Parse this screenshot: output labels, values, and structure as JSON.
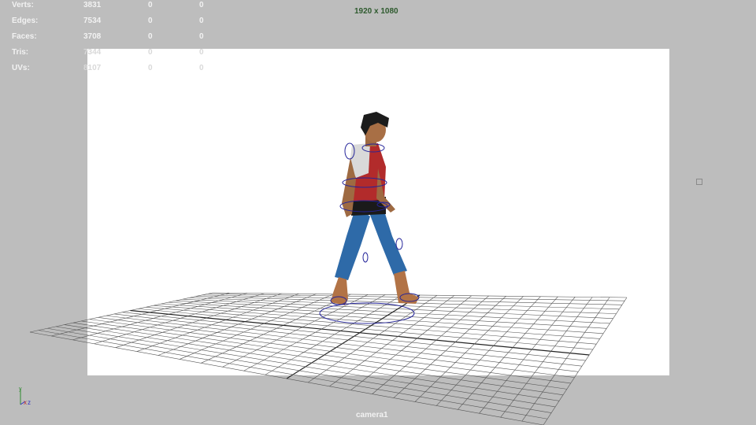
{
  "hud": {
    "rows": [
      {
        "label": "Verts:",
        "v1": "3831",
        "v2": "0",
        "v3": "0"
      },
      {
        "label": "Edges:",
        "v1": "7534",
        "v2": "0",
        "v3": "0"
      },
      {
        "label": "Faces:",
        "v1": "3708",
        "v2": "0",
        "v3": "0"
      },
      {
        "label": "Tris:",
        "v1": "7344",
        "v2": "0",
        "v3": "0"
      },
      {
        "label": "UVs:",
        "v1": "8107",
        "v2": "0",
        "v3": "0"
      }
    ]
  },
  "viewport": {
    "resolution": "1920 x 1080",
    "camera": "camera1",
    "background_color": "#bdbdbd",
    "gate_color": "#ffffff"
  },
  "axis": {
    "x": "x",
    "y": "y",
    "z": "z"
  },
  "icons": [
    "axis-icon",
    "gate-marker-icon"
  ]
}
